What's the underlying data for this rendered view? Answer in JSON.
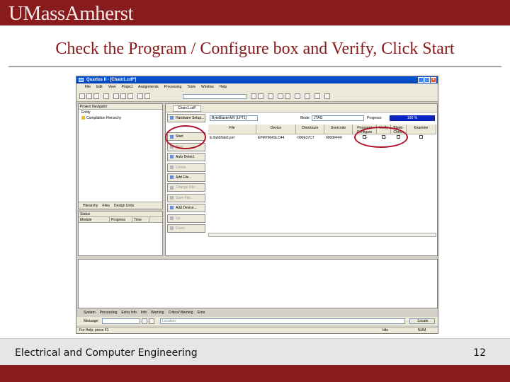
{
  "header": {
    "logo": "UMassAmherst",
    "brand_color": "#881c1c"
  },
  "slide": {
    "title": "Check the Program / Configure box and Verify, Click Start"
  },
  "screenshot": {
    "window_title": "Quartus II - [Chain1.cdf*]",
    "menu": [
      "File",
      "Edit",
      "View",
      "Project",
      "Assignments",
      "Processing",
      "Tools",
      "Window",
      "Help"
    ],
    "navigator": {
      "title": "Project Navigator",
      "entity": "Entity",
      "item": "Compilation Hierarchy",
      "tabs": [
        "Hierarchy",
        "Files",
        "Design Units"
      ]
    },
    "status_panel": {
      "title": "Status",
      "columns": [
        "Module",
        "Progress",
        "Time"
      ]
    },
    "programmer": {
      "tab": "Chain1.cdf*",
      "hardware_setup": "Hardware Setup...",
      "hardware": "ByteBlasterMV [LPT1]",
      "mode_label": "Mode:",
      "mode": "JTAG",
      "progress_label": "Progress:",
      "progress": "100 %",
      "progress_value": 1.0,
      "side_buttons": [
        "Start",
        "Stop",
        "Auto Detect",
        "Delete",
        "Add File...",
        "Change File...",
        "Save File...",
        "Add Device...",
        "Up",
        "Down"
      ],
      "columns": [
        "File",
        "Device",
        "Checksum",
        "Usercode",
        "Program/ Configure",
        "Verify",
        "Blank- Check",
        "Examine"
      ],
      "rows": [
        {
          "file": "E:/lab0/lab0.pof",
          "device": "EPM7064SLC44",
          "checksum": "000E37C7",
          "usercode": "0000FFFF",
          "program": "✓",
          "verify": "✓",
          "blank": "",
          "examine": ""
        }
      ]
    },
    "message_tabs": [
      "System",
      "Processing",
      "Extra Info",
      "Info",
      "Warning",
      "Critical Warning",
      "Error"
    ],
    "message_label": "Message:",
    "location_placeholder": "Location:",
    "locate_button": "Locate",
    "status_text": "For Help, press F1",
    "status_right": [
      "Idle",
      "NUM"
    ],
    "highlight_color": "#b0102a"
  },
  "footer": {
    "text": "Electrical and Computer Engineering",
    "page": "12"
  }
}
